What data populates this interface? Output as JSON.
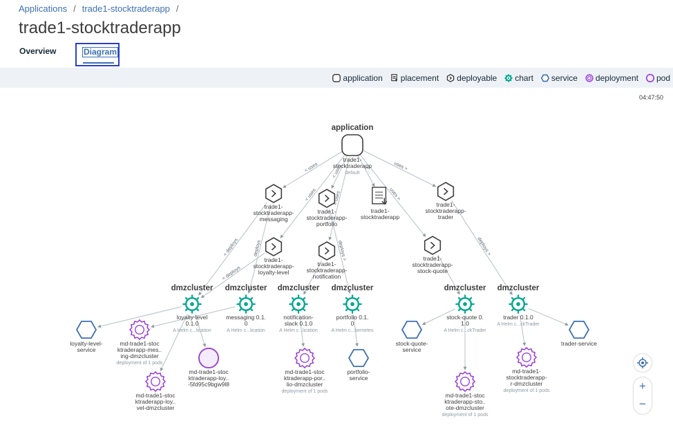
{
  "breadcrumb": [
    "Applications",
    "trade1-stocktraderapp"
  ],
  "page_title": "trade1-stocktraderapp",
  "tabs": {
    "overview": "Overview",
    "diagram": "Diagram"
  },
  "legend": [
    {
      "label": "application",
      "icon": "application-icon"
    },
    {
      "label": "placement",
      "icon": "placement-icon"
    },
    {
      "label": "deployable",
      "icon": "deployable-icon"
    },
    {
      "label": "chart",
      "icon": "chart-icon"
    },
    {
      "label": "service",
      "icon": "service-icon"
    },
    {
      "label": "deployment",
      "icon": "deployment-icon"
    },
    {
      "label": "pod",
      "icon": "pod-icon"
    }
  ],
  "timestamp": "04:47:50",
  "colors": {
    "teal": "#00a78f",
    "purple": "#9c42d8",
    "blue": "#3d70b2",
    "dark": "#3d3d3d"
  },
  "nodes": [
    {
      "id": "app",
      "type": "application",
      "top": "application",
      "lines": [
        "trade1-",
        "stocktraderapp"
      ],
      "sub": "default"
    },
    {
      "id": "msg",
      "type": "deployable",
      "lines": [
        "trade1-",
        "stocktraderapp-",
        "messaging"
      ]
    },
    {
      "id": "port",
      "type": "deployable",
      "lines": [
        "trade1-",
        "stocktraderapp-",
        "portfolio"
      ]
    },
    {
      "id": "plc",
      "type": "placement",
      "lines": [
        "trade1-",
        "stocktraderapp"
      ]
    },
    {
      "id": "trd",
      "type": "deployable",
      "lines": [
        "trade1-",
        "stocktraderapp-",
        "trader"
      ]
    },
    {
      "id": "loy",
      "type": "deployable",
      "lines": [
        "trade1-",
        "stocktraderapp-",
        "loyalty-level"
      ]
    },
    {
      "id": "ntf",
      "type": "deployable",
      "lines": [
        "trade1-",
        "stocktraderapp-",
        "notification"
      ]
    },
    {
      "id": "sq",
      "type": "deployable",
      "lines": [
        "trade1-",
        "stocktraderapp-",
        "stock-quote"
      ]
    },
    {
      "id": "c1",
      "type": "chart",
      "top": "dmzcluster",
      "lines": [
        "loyalty-level",
        "0.1.0"
      ],
      "sub": "A Helm c...lication"
    },
    {
      "id": "c2",
      "type": "chart",
      "top": "dmzcluster",
      "lines": [
        "messaging 0.1.",
        "0"
      ],
      "sub": "A Helm c...lication"
    },
    {
      "id": "c3",
      "type": "chart",
      "top": "dmzcluster",
      "lines": [
        "notification-",
        "slack 0.1.0"
      ],
      "sub": "A Helm c...lication"
    },
    {
      "id": "c4",
      "type": "chart",
      "top": "dmzcluster",
      "lines": [
        "portfolio 0.1.",
        "0"
      ],
      "sub": "A Helm c...bernetes"
    },
    {
      "id": "c5",
      "type": "chart",
      "top": "dmzcluster",
      "lines": [
        "stock-quote 0.",
        "1.0"
      ],
      "sub": "A Helm c...ckTrader"
    },
    {
      "id": "c6",
      "type": "chart",
      "top": "dmzcluster",
      "lines": [
        "trader 0.1.0"
      ],
      "sub": "A Helm c...ckTrader"
    },
    {
      "id": "s1",
      "type": "service",
      "lines": [
        "loyalty-level-",
        "service"
      ]
    },
    {
      "id": "d1",
      "type": "deployment",
      "lines": [
        "md-trade1-stoc",
        "ktraderapp-mes..",
        "ing-dmzcluster"
      ],
      "sub": "deployment of 1 pods"
    },
    {
      "id": "d2",
      "type": "deployment",
      "lines": [
        "md-trade1-stoc",
        "ktraderapp-loy..",
        "vel-dmzcluster"
      ]
    },
    {
      "id": "p1",
      "type": "pod",
      "lines": [
        "md-trade1-stoc",
        "ktraderapp-loy..",
        "-5fd95c9bgw9l8"
      ]
    },
    {
      "id": "d3",
      "type": "deployment",
      "lines": [
        "md-trade1-stoc",
        "ktraderapp-por..",
        "lio-dmzcluster"
      ],
      "sub": "deployment of 1 pods"
    },
    {
      "id": "s2",
      "type": "service",
      "lines": [
        "portfolio-",
        "service"
      ]
    },
    {
      "id": "s3",
      "type": "service",
      "lines": [
        "stock-quote-",
        "service"
      ]
    },
    {
      "id": "d4",
      "type": "deployment",
      "lines": [
        "md-trade1-stoc",
        "ktraderapp-sto..",
        "ote-dmzcluster"
      ],
      "sub": "deployment of 1 pods"
    },
    {
      "id": "d5",
      "type": "deployment",
      "lines": [
        "md-trade1-",
        "stocktraderapp-",
        "r-dmzcluster"
      ],
      "sub": "deployment of 1 pods"
    },
    {
      "id": "s4",
      "type": "service",
      "lines": [
        "trader-service"
      ]
    }
  ],
  "edges": [
    {
      "from": "app",
      "to": "msg",
      "label": "< uses"
    },
    {
      "from": "app",
      "to": "port",
      "label": "< uses"
    },
    {
      "from": "app",
      "to": "plc",
      "label": "> ..."
    },
    {
      "from": "app",
      "to": "sq",
      "label": "uses >"
    },
    {
      "from": "app",
      "to": "trd",
      "label": "uses >"
    },
    {
      "from": "app",
      "to": "loy",
      "label": "< uses"
    },
    {
      "from": "app",
      "to": "ntf",
      "label": "< uses"
    },
    {
      "from": "msg",
      "to": "c2",
      "label": "deploys"
    },
    {
      "from": "msg",
      "to": "c1",
      "label": "< deploys"
    },
    {
      "from": "loy",
      "to": "c1",
      "label": "< deploys"
    },
    {
      "from": "port",
      "to": "c4",
      "label": "deploys >"
    },
    {
      "from": "ntf",
      "to": "c3",
      "label": ""
    },
    {
      "from": "sq",
      "to": "c5",
      "label": ""
    },
    {
      "from": "trd",
      "to": "c6",
      "label": "deploys >"
    },
    {
      "from": "c1",
      "to": "s1",
      "label": ""
    },
    {
      "from": "c2",
      "to": "d1",
      "label": ""
    },
    {
      "from": "c1",
      "to": "d2",
      "label": ""
    },
    {
      "from": "c1",
      "to": "p1",
      "label": ""
    },
    {
      "from": "c3",
      "to": "d3",
      "label": ""
    },
    {
      "from": "c4",
      "to": "s2",
      "label": ""
    },
    {
      "from": "c5",
      "to": "s3",
      "label": ""
    },
    {
      "from": "c5",
      "to": "d4",
      "label": ""
    },
    {
      "from": "c6",
      "to": "d5",
      "label": ""
    },
    {
      "from": "c6",
      "to": "s4",
      "label": ""
    }
  ]
}
